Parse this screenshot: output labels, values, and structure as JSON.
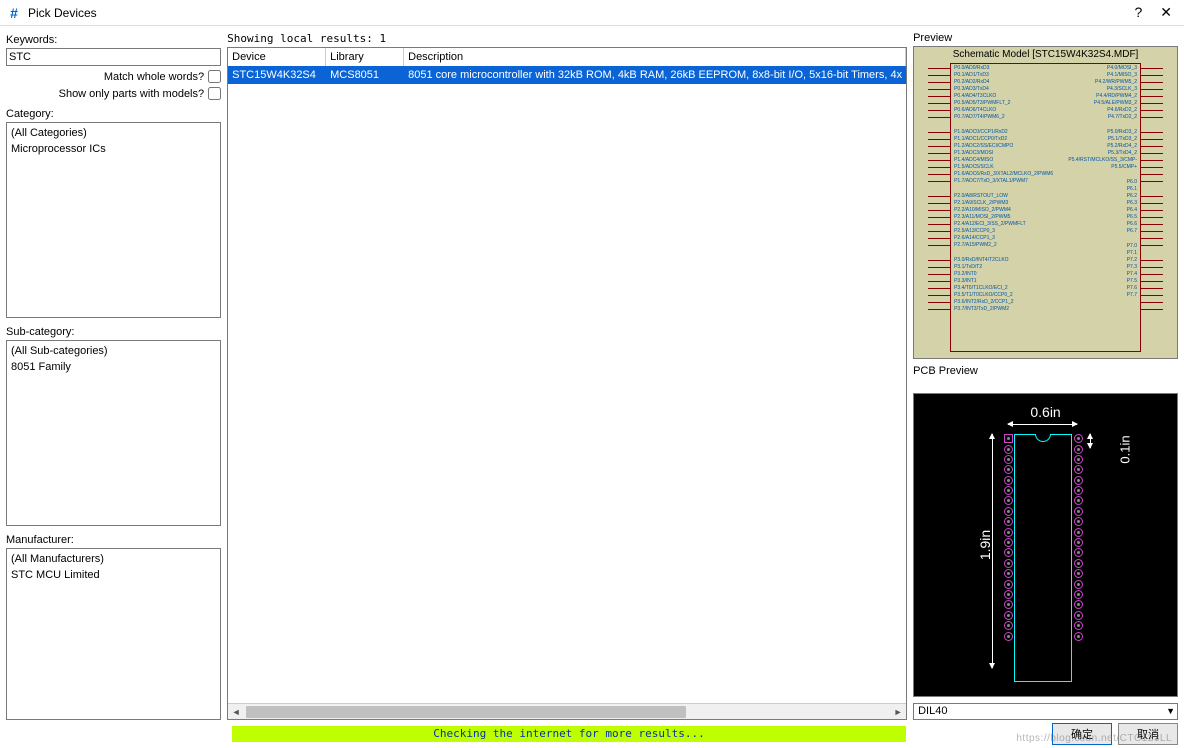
{
  "window": {
    "title": "Pick Devices"
  },
  "left": {
    "keywords_label": "Keywords:",
    "keywords_value": "STC",
    "match_whole": "Match whole words?",
    "show_only_models": "Show only parts with models?",
    "category_label": "Category:",
    "category_items": [
      "(All Categories)",
      "Microprocessor ICs"
    ],
    "subcategory_label": "Sub-category:",
    "subcategory_items": [
      "(All Sub-categories)",
      "8051 Family"
    ],
    "manufacturer_label": "Manufacturer:",
    "manufacturer_items": [
      "(All Manufacturers)",
      "STC MCU Limited"
    ]
  },
  "mid": {
    "status": "Showing local results: 1",
    "columns": {
      "device": "Device",
      "library": "Library",
      "description": "Description"
    },
    "row": {
      "device": "STC15W4K32S4",
      "library": "MCS8051",
      "description": "8051 core microcontroller with 32kB ROM, 4kB RAM, 26kB EEPROM, 8x8-bit I/O, 5x16-bit Timers, 4x"
    }
  },
  "right": {
    "preview_label": "Preview",
    "schem_title": "Schematic Model [STC15W4K32S4.MDF]",
    "pins_left_block1": [
      "P0.0/AD0/RxD3",
      "P0.1/AD1/TxD3",
      "P0.2/AD2/RxD4",
      "P0.3/AD3/TxD4",
      "P0.4/AD4/T3CLKO",
      "P0.5/AD5/T3/PWMFLT_2",
      "P0.6/AD6/T4CLKO",
      "P0.7/AD7/T4/PWM6_2"
    ],
    "pins_right_block1": [
      "P4.0/MOSI_3",
      "P4.1/MISO_3",
      "P4.2/WR/PWM5_2",
      "P4.3/SCLK_3",
      "P4.4/RD/PWM4_2",
      "P4.5/ALE/PWM3_2",
      "P4.6/RxD2_2",
      "P4.7/TxD2_2"
    ],
    "pins_left_block2": [
      "P1.0/ADC0/CCP1/RxD2",
      "P1.1/ADC1/CCP0/TxD2",
      "P1.2/ADC2/SS/ECI/CMPO",
      "P1.3/ADC3/MOSI",
      "P1.4/ADC4/MISO",
      "P1.5/ADC5/SCLK",
      "P1.6/ADC6/RxD_3/XTAL2/MCLKO_2/PWM6",
      "P1.7/ADC7/TxD_3/XTAL1/PWM7"
    ],
    "pins_right_block2": [
      "P5.0/RxD3_2",
      "P5.1/TxD3_2",
      "P5.2/RxD4_2",
      "P5.3/TxD4_2",
      "P5.4/RST/MCLKO/SS_3/CMP-",
      "P5.5/CMP+",
      "",
      ""
    ],
    "pins_left_block3": [
      "P2.0/A8/RSTOUT_LOW",
      "P2.1/A9/SCLK_2/PWM3",
      "P2.2/A10/MISO_2/PWM4",
      "P2.3/A11/MOSI_2/PWM5",
      "P2.4/A12/ECI_3/SS_2/PWMFLT",
      "P2.5/A13/CCP0_3",
      "P2.6/A14/CCP1_3",
      "P2.7/A15/PWM2_2"
    ],
    "pins_right_block3": [
      "P6.0",
      "P6.1",
      "P6.2",
      "P6.3",
      "P6.4",
      "P6.5",
      "P6.6",
      "P6.7"
    ],
    "pins_left_block4": [
      "P3.0/RxD/INT4/T2CLKO",
      "P3.1/TxD/T2",
      "P3.2/INT0",
      "P3.3/INT1",
      "P3.4/T0/T1CLKO/ECI_2",
      "P3.5/T1/T0CLKO/CCP0_2",
      "P3.6/INT2/RxD_2/CCP1_2",
      "P3.7/INT3/TxD_2/PWM2"
    ],
    "pins_right_block4": [
      "P7.0",
      "P7.1",
      "P7.2",
      "P7.3",
      "P7.4",
      "P7.5",
      "P7.6",
      "P7.7"
    ],
    "pcb_label": "PCB Preview",
    "pcb_dims": {
      "width": "0.6in",
      "height": "1.9in",
      "pitch": "0.1in"
    },
    "package": "DIL40"
  },
  "bottom": {
    "checking": "Checking the internet for more results...",
    "ok": "确定",
    "cancel": "取消"
  },
  "watermark": "https://blog.csdn.net/CTC123LL"
}
